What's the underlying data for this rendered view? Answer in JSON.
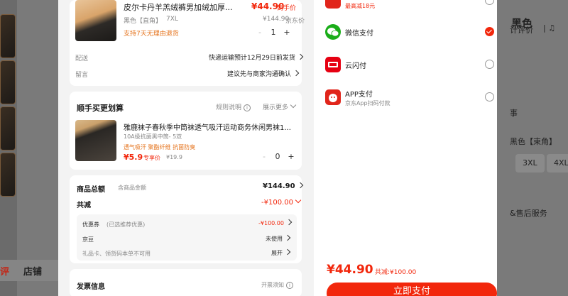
{
  "product": {
    "title": "皮尔卡丹羊羔绒裤男加绒加厚...",
    "price": "¥44.90",
    "price_tag": "到手价",
    "variant": "黑色【直角】",
    "size": "7XL",
    "original_price": "¥144.90",
    "price_source": "京东价",
    "return_policy": "支持7天无理由退货",
    "quantity": "1",
    "minus": "-",
    "plus": "+"
  },
  "shipping": {
    "label": "配送",
    "value": "快递运输预计12月29日前发货"
  },
  "message": {
    "label": "留言",
    "value": "建议先与商家沟通确认"
  },
  "addon": {
    "title": "顺手买更划算",
    "rules": "规则说明",
    "more": "展示更多",
    "item_title": "雅鹿袜子春秋季中筒袜透气吸汗运动商务休闲男袜1...",
    "item_spec": "10A级抗菌黑中筒- 5双",
    "item_tags": "透气吸汗 聚酯纤维 抗菌防臭",
    "item_price": "¥5.9",
    "item_price_tag": "专享价",
    "item_original": "¥19.9",
    "item_qty": "0",
    "minus": "-",
    "plus": "+"
  },
  "summary": {
    "total_label": "商品总额",
    "total_note": "含商品金额",
    "total_value": "¥144.90",
    "discount_label": "共减",
    "discount_value": "-¥100.00",
    "coupon_label": "优惠券",
    "coupon_note": "(已选推荐优惠)",
    "coupon_value": "-¥100.00",
    "jingdou_label": "京豆",
    "jingdou_value": "未使用",
    "giftcard_label": "礼品卡、领货码本单不可用",
    "giftcard_value": "展开"
  },
  "invoice": {
    "label": "发票信息",
    "note": "开票须知"
  },
  "payment": {
    "top_promo": "最高减18元",
    "methods": [
      {
        "name": "微信支付",
        "sub": "",
        "selected": true
      },
      {
        "name": "云闪付",
        "sub": "",
        "selected": false
      },
      {
        "name": "APP支付",
        "sub": "京东App扫码付款",
        "selected": false
      }
    ],
    "total": "¥44.90",
    "saved": "共减:¥100.00",
    "button": "立即支付"
  },
  "background": {
    "tab_review": "评",
    "tab_store": "店铺",
    "right_title": "黑色",
    "right_rating": "计评价",
    "right_color": "黑色【束角】",
    "chip_3xl": "3XL",
    "chip_4xl": "4XL",
    "right_service": "&售后服务",
    "right_char": "事"
  },
  "colors": {
    "accent": "#f2270c",
    "wechat": "#1aad19",
    "unionpay": "#e60012",
    "jd": "#e1251b"
  }
}
